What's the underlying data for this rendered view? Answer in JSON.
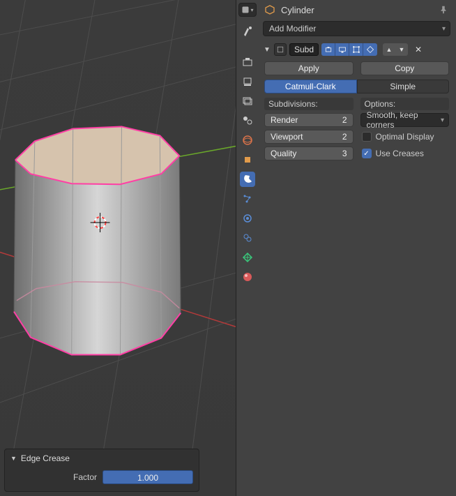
{
  "header": {
    "object_name": "Cylinder"
  },
  "add_modifier_label": "Add Modifier",
  "modifier": {
    "name": "Subd",
    "apply_label": "Apply",
    "copy_label": "Copy",
    "type_options": {
      "catmull": "Catmull-Clark",
      "simple": "Simple"
    },
    "subdivisions_header": "Subdivisions:",
    "options_header": "Options:",
    "render": {
      "label": "Render",
      "value": "2"
    },
    "viewport": {
      "label": "Viewport",
      "value": "2"
    },
    "quality": {
      "label": "Quality",
      "value": "3"
    },
    "uv_smooth": "Smooth, keep corners",
    "optimal_display": {
      "label": "Optimal Display",
      "checked": false
    },
    "use_creases": {
      "label": "Use Creases",
      "checked": true
    }
  },
  "operator": {
    "title": "Edge Crease",
    "factor_label": "Factor",
    "factor_value": "1.000"
  }
}
